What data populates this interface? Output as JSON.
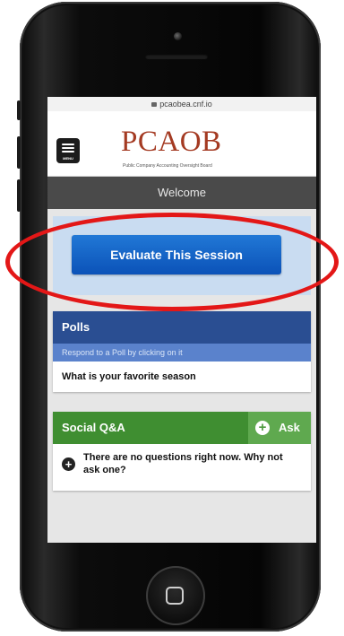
{
  "browser": {
    "url": "pcaobea.cnf.io"
  },
  "header": {
    "menu_label": "MENU",
    "logo_text": "PCAOB",
    "logo_subtitle": "Public Company Accounting Oversight Board"
  },
  "welcome": {
    "title": "Welcome"
  },
  "evaluate": {
    "button_label": "Evaluate This Session"
  },
  "polls": {
    "title": "Polls",
    "subtitle": "Respond to a Poll by clicking on it",
    "items": [
      {
        "label": "What is your favorite season"
      }
    ]
  },
  "qa": {
    "title": "Social Q&A",
    "ask_label": "Ask",
    "empty_message": "There are no questions right now. Why not ask one?"
  },
  "colors": {
    "brand": "#a43a22",
    "evaluate_button": "#0b52b8",
    "polls_header": "#2a4e92",
    "qa_header": "#3f8e31",
    "highlight": "#e31717"
  },
  "icons": {
    "menu": "hamburger-icon",
    "lock": "lock-icon",
    "ask": "plus-circle-icon",
    "question": "plus-circle-icon",
    "home": "home-button-icon"
  }
}
